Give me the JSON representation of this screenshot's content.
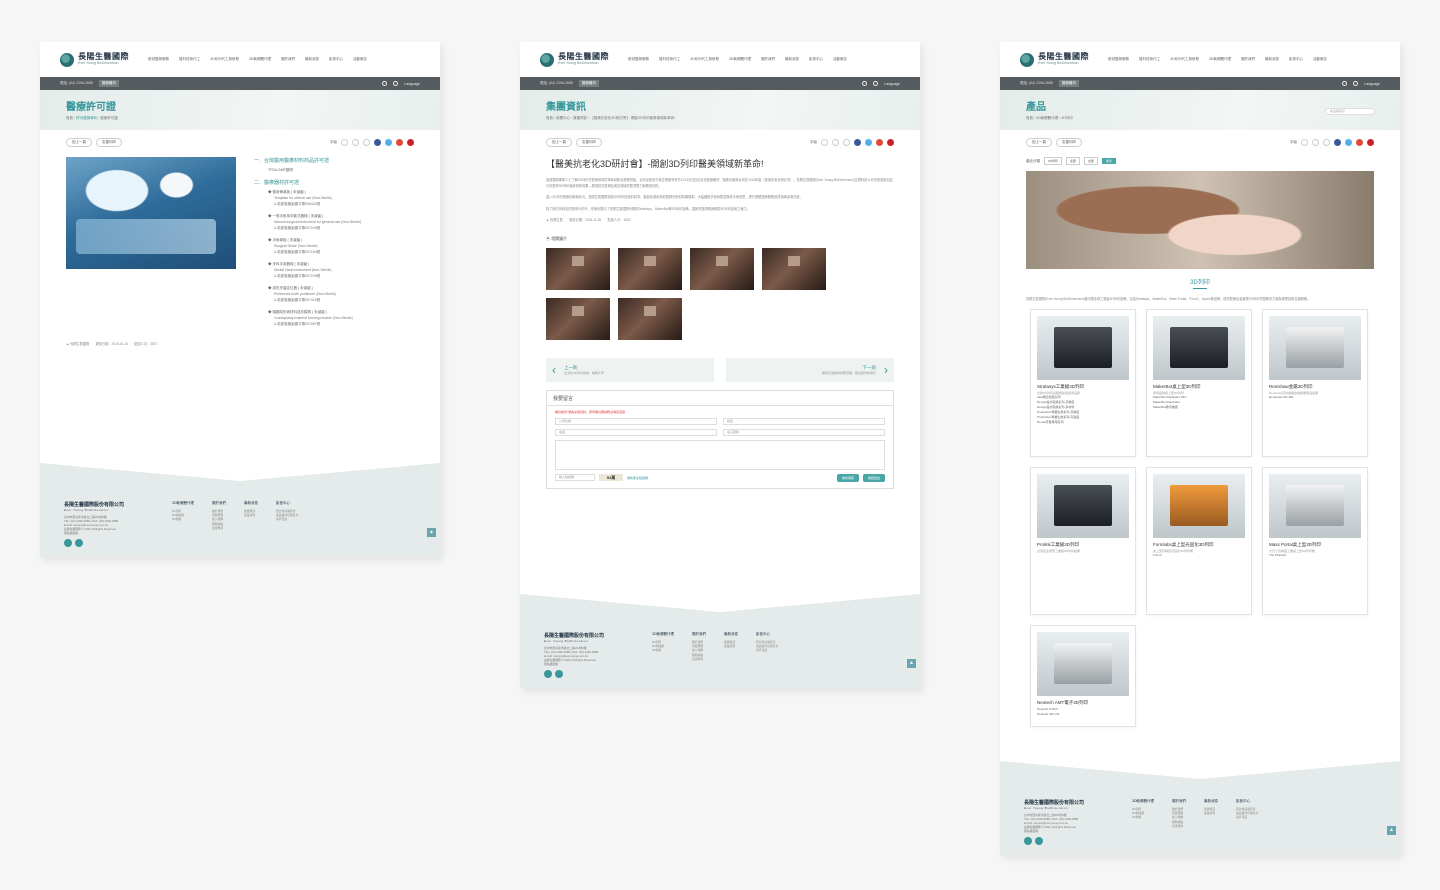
{
  "header": {
    "logo_zh": "長陽生醫國際",
    "logo_en": "Ever Young BioDimension",
    "nav": [
      "新冠醫療服務",
      "醫材技術代工",
      "3D系列代工與研發",
      "3D軟硬體代理",
      "關於我們",
      "最新消息",
      "影音中心",
      "活動報名"
    ],
    "tel": "電話: (04) 2296-2688",
    "badge": "醫療器材",
    "language": "Language"
  },
  "common": {
    "back_label": "回上一頁",
    "print_label": "友善列印",
    "font_size_label": "字級",
    "font_sizes": [
      "A",
      "A",
      "A"
    ]
  },
  "page1": {
    "title": "醫療許可證",
    "crumb_home": "首頁",
    "crumb_mid": "許可證與專利",
    "crumb_current": "醫療許可證",
    "section1": "一．台灣醫用醫療材料商品許可證",
    "section1_items": [
      "TFDA GMP證明"
    ],
    "section2": "二．醫療器材許可證",
    "groups": [
      {
        "title": "◆ 醫用骨導板 ( 未滅菌 )",
        "en": "Template for clinical use (Non-Sterile)",
        "no": "● 衛部醫器製壹字第006430號"
      },
      {
        "title": "◆ 一般手術用手動式器械 ( 未滅菌 )",
        "en": "Manual surgical instrument for general use (Non-Sterile)",
        "no": "● 衛部醫器製壹字第007243號"
      },
      {
        "title": "◆ 手術導板 ( 未滅菌 )",
        "en": "Surgical Guide (Non-Sterile)",
        "no": "● 衛部醫器製壹字第007154號"
      },
      {
        "title": "◆ 牙科手用器械 ( 未滅菌 )",
        "en": "Dental Hand instrument (Non-Sterile)",
        "no": "● 衛部醫器製壹字第007225號"
      },
      {
        "title": "◆ 成形牙齒定位器 ( 未滅菌 )",
        "en": "Preformed tooth positioner (Non-Sterile)",
        "no": "● 衛部醫器製壹字第007415號"
      },
      {
        "title": "◆ 頭顱成形術材料成形模具 ( 未滅菌 )",
        "en": "Cranioplasty material forming module (Non-Sterile)",
        "no": "● 衛部醫器製壹字第007067號"
      }
    ],
    "meta": "▲ 長陽生醫國際　　更新日期：2018-10-16　　點閱人次：3872"
  },
  "page2": {
    "title": "集團資訊",
    "crumb_home": "首頁",
    "crumb_mid": "新聞中心",
    "crumb_sub": "集團資訊",
    "crumb_current": "【醫美抗老化3D研討會】-開創3D列印醫美領域新革命!",
    "article_title": "【醫美抗老化3D研討會】-開創3D列印醫美領域新革命!",
    "paragraphs": [
      "為讓醫師專業人士了解3D列印在醫療領域的革命創新及發展潛能，台灣全醫而方美生物醫學會於11/15日(四)在台北醫療器材、醫師出席與台灣在2018年度（醫美抗老化研討會）。長陽生醫國際(Ever Young BioDimension)生物科技公司也受邀參加並分享醫學3D列印最新研發成果，展現其在醫療及美容領域的雙重實力與應用情形。",
      "邁入3D列印醫療創新新紀元，長陽生醫國際透過3D列印技術的精準、客製化優勢幫助醫師在術前精確規劃，大幅縮短手術時間並降低手術風險，提升整體醫療服務品質與病患滿意度。",
      "除了研討會精彩的醫學分享外，會場也展示了長陽生醫國際代理的Stratasys、MakerBot等3D列印設備，讓與會醫師親身體驗3D列印技術之魅力。"
    ],
    "meta": "▲ 長陽生醫　　更新日期：2018-11-26　　點閱人次：1530",
    "gallery_label": "相關圖片",
    "prev_label": "上一則",
    "prev_title": "生活化3D列印技術：陽明大學",
    "next_label": "下一則",
    "next_title": "醫院引進醫療供應流程：數位醫學新時代",
    "form_title": "我要留言",
    "form_note": "欄位前有*號為必填資料，所有欄位都請務必填寫完整",
    "field_company": "公司名稱",
    "field_name": "姓名",
    "field_phone": "電話",
    "field_email": "電子郵箱",
    "captcha_label": "輸入驗證碼",
    "captcha_code": "92萬",
    "refresh_label": "重新產生驗證碼",
    "btn_reset": "重新填寫",
    "btn_submit": "確認送出"
  },
  "page3": {
    "title": "產品",
    "crumb_home": "首頁",
    "crumb_mid": "3D軟硬體代理",
    "crumb_current": "3D列印",
    "search_placeholder": "產品關鍵字",
    "filter_label": "產品分類",
    "filter_values": [
      "3D列印",
      "全部",
      "全部"
    ],
    "filter_go": "搜尋",
    "section_title": "3D列印",
    "intro": "長陽生醫國際(Ever Young BioDimension)總代理全球工業級3D列印設備，包括Stratasys、MakerBot、Mass Portal、Form2、Apollo等品牌，提供醫療及各產業3D列印完整解決方案與專業技術支援服務。",
    "products": [
      {
        "name": "Stratasys工業級3D列印",
        "desc": "全球3D列印與積層製造領導品牌",
        "items": [
          "Idea概念模型系列",
          "Design設計驗證系列-高精度",
          "Design設計驗證系列-多材料",
          "Production專業生產系列-高精度",
          "Production專業生產系列-高強度",
          "Dental牙醫專用系列"
        ],
        "style": "dark"
      },
      {
        "name": "MakerBot桌上型3D列印",
        "desc": "領導品牌桌上型3D列印",
        "items": [
          "MakerBot Replicator Mini",
          "MakerBot Replicator",
          "MakerBot教育推廣"
        ],
        "style": "dark"
      },
      {
        "name": "Renishaw金屬3D列印",
        "desc": "Renishaw雷射熔融金屬積層製造設備",
        "items": [
          "Renishaw AM 400"
        ],
        "style": "light"
      },
      {
        "name": "Prolink工業級3D列印",
        "desc": "台灣自主研發工業級3D列印設備",
        "items": [],
        "style": "dark"
      },
      {
        "name": "Formlabs桌上型光固化3D列印",
        "desc": "桌上型高精度光固化3D列印機",
        "items": [
          "Form2"
        ],
        "style": "orange"
      },
      {
        "name": "Mass Portal桌上型3D列印",
        "desc": "大尺寸高精度工業桌上型3D列印機",
        "items": [
          "The Pharaoh"
        ],
        "style": "light"
      },
      {
        "name": "Neotech AMT電子3D列印",
        "desc": "",
        "items": [
          "Neotech PJ15X",
          "Neotech 45X-G3"
        ],
        "style": "light"
      }
    ]
  },
  "footer": {
    "company_zh": "長陽生醫國際股份有限公司",
    "company_en": "Ever Young BioDimension",
    "address": "台中市西屯區市政北二路282號8樓",
    "tel_fax": "TEL: (04) 2296-2688 | FAX: (04) 2296-3888",
    "email": "E-mail: service@everyoung.com.tw",
    "copyright": "長陽生醫國際 © 2021 All Rights Reserved",
    "privacy": "隱私權政策",
    "cols": [
      {
        "title": "3D軟硬體代理",
        "links": [
          "3D列印",
          "3D掃描器",
          "3D軟體"
        ]
      },
      {
        "title": "關於我們",
        "links": [
          "關於我們",
          "發展歷程",
          "加入團隊",
          "服務據點",
          "認證專利"
        ]
      },
      {
        "title": "最新消息",
        "links": [
          "集團資訊",
          "產業新知"
        ]
      },
      {
        "title": "影音中心",
        "links": [
          "研討會演講影音",
          "產品操作示範影片",
          "客戶見證"
        ]
      }
    ]
  }
}
